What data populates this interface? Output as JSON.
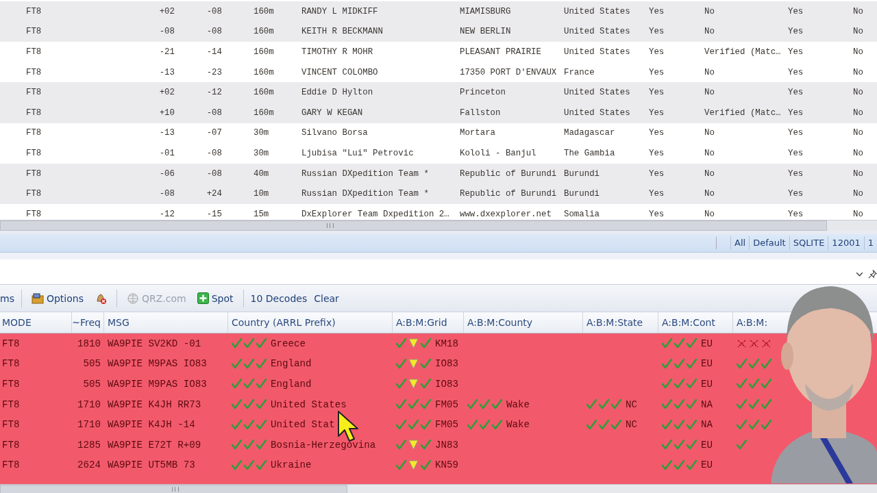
{
  "log_table": {
    "rows": [
      {
        "shaded": true,
        "cells": [
          "FT8",
          "+02",
          "-08",
          "160m",
          "RANDY L MIDKIFF",
          "MIAMISBURG",
          "United States",
          "Yes",
          "No",
          "Yes",
          "No"
        ]
      },
      {
        "shaded": true,
        "cells": [
          "FT8",
          "-08",
          "-08",
          "160m",
          "KEITH R BECKMANN",
          "NEW BERLIN",
          "United States",
          "Yes",
          "No",
          "Yes",
          "No"
        ]
      },
      {
        "shaded": false,
        "cells": [
          "FT8",
          "-21",
          "-14",
          "160m",
          "TIMOTHY R MOHR",
          "PLEASANT PRAIRIE",
          "United States",
          "Yes",
          "Verified (Matc…",
          "Yes",
          "No"
        ]
      },
      {
        "shaded": false,
        "cells": [
          "FT8",
          "-13",
          "-23",
          "160m",
          "VINCENT COLOMBO",
          "17350 PORT D'ENVAUX",
          "France",
          "Yes",
          "No",
          "Yes",
          "No"
        ]
      },
      {
        "shaded": true,
        "cells": [
          "FT8",
          "+02",
          "-12",
          "160m",
          "Eddie D Hylton",
          "Princeton",
          "United States",
          "Yes",
          "No",
          "Yes",
          "No"
        ]
      },
      {
        "shaded": true,
        "cells": [
          "FT8",
          "+10",
          "-08",
          "160m",
          "GARY W KEGAN",
          "Fallston",
          "United States",
          "Yes",
          "Verified (Matc…",
          "Yes",
          "No"
        ]
      },
      {
        "shaded": false,
        "cells": [
          "FT8",
          "-13",
          "-07",
          "30m",
          "Silvano Borsa",
          "Mortara",
          "Madagascar",
          "Yes",
          "No",
          "Yes",
          "No"
        ]
      },
      {
        "shaded": false,
        "cells": [
          "FT8",
          "-01",
          "-08",
          "30m",
          "Ljubisa \"Lui\" Petrovic",
          "Kololi - Banjul",
          "The Gambia",
          "Yes",
          "No",
          "Yes",
          "No"
        ]
      },
      {
        "shaded": true,
        "cells": [
          "FT8",
          "-06",
          "-08",
          "40m",
          "Russian DXpedition Team *",
          "Republic of Burundi",
          "Burundi",
          "Yes",
          "No",
          "Yes",
          "No"
        ]
      },
      {
        "shaded": true,
        "cells": [
          "FT8",
          "-08",
          "+24",
          "10m",
          "Russian DXpedition Team *",
          "Republic of Burundi",
          "Burundi",
          "Yes",
          "No",
          "Yes",
          "No"
        ]
      },
      {
        "shaded": false,
        "cells": [
          "FT8",
          "-12",
          "-15",
          "15m",
          "DxExplorer Team Dxpedition 2…",
          "www.dxexplorer.net",
          "Somalia",
          "Yes",
          "No",
          "Yes",
          "No"
        ]
      }
    ]
  },
  "status_bar": {
    "panes": [
      "All",
      "Default",
      "SQLITE",
      "12001",
      "1"
    ]
  },
  "toolbar": {
    "cut_item": "ms",
    "options_button": "Options",
    "qrz_button": {
      "label": "QRZ.com",
      "disabled": true
    },
    "spot_button": "Spot",
    "decodes_count": "10 Decodes",
    "clear_button": "Clear"
  },
  "decodes_table": {
    "columns": [
      "MODE",
      "~Freq",
      "MSG",
      "Country (ARRL Prefix)",
      "A:B:M:Grid",
      "A:B:M:County",
      "A:B:M:State",
      "A:B:M:Cont",
      "A:B:M:"
    ],
    "rows": [
      {
        "mode": "FT8",
        "freq": "1810",
        "msg": "WA9PIE SV2KD -01",
        "country": {
          "marks": [
            {
              "kind": "check"
            },
            {
              "kind": "check"
            },
            {
              "kind": "check"
            }
          ],
          "text": "Greece"
        },
        "grid": {
          "marks": [
            {
              "kind": "check"
            },
            {
              "kind": "warn"
            },
            {
              "kind": "check"
            }
          ],
          "text": "KM18"
        },
        "cont": {
          "marks": [
            {
              "kind": "check"
            },
            {
              "kind": "check"
            },
            {
              "kind": "check"
            }
          ],
          "text": "EU"
        },
        "column_9": {
          "marks": [
            {
              "kind": "cross"
            },
            {
              "kind": "cross"
            },
            {
              "kind": "cross"
            }
          ]
        }
      },
      {
        "mode": "FT8",
        "freq": "505",
        "msg": "WA9PIE M9PAS IO83",
        "country": {
          "marks": [
            {
              "kind": "check"
            },
            {
              "kind": "check"
            },
            {
              "kind": "check"
            }
          ],
          "text": "England"
        },
        "grid": {
          "marks": [
            {
              "kind": "check"
            },
            {
              "kind": "warn"
            },
            {
              "kind": "check"
            }
          ],
          "text": "IO83"
        },
        "cont": {
          "marks": [
            {
              "kind": "check"
            },
            {
              "kind": "check"
            },
            {
              "kind": "check"
            }
          ],
          "text": "EU"
        },
        "column_9": {
          "marks": [
            {
              "kind": "check"
            },
            {
              "kind": "check"
            },
            {
              "kind": "check"
            }
          ]
        }
      },
      {
        "mode": "FT8",
        "freq": "505",
        "msg": "WA9PIE M9PAS IO83",
        "country": {
          "marks": [
            {
              "kind": "check"
            },
            {
              "kind": "check"
            },
            {
              "kind": "check"
            }
          ],
          "text": "England"
        },
        "grid": {
          "marks": [
            {
              "kind": "check"
            },
            {
              "kind": "warn"
            },
            {
              "kind": "check"
            }
          ],
          "text": "IO83"
        },
        "cont": {
          "marks": [
            {
              "kind": "check"
            },
            {
              "kind": "check"
            },
            {
              "kind": "check"
            }
          ],
          "text": "EU"
        },
        "column_9": {
          "marks": [
            {
              "kind": "check"
            },
            {
              "kind": "check"
            },
            {
              "kind": "check"
            }
          ]
        }
      },
      {
        "mode": "FT8",
        "freq": "1710",
        "msg": "WA9PIE K4JH RR73",
        "country": {
          "marks": [
            {
              "kind": "check"
            },
            {
              "kind": "check"
            },
            {
              "kind": "check"
            }
          ],
          "text": "United States"
        },
        "grid": {
          "marks": [
            {
              "kind": "check"
            },
            {
              "kind": "check"
            },
            {
              "kind": "check"
            }
          ],
          "text": "FM05"
        },
        "county": {
          "marks": [
            {
              "kind": "check"
            },
            {
              "kind": "check"
            },
            {
              "kind": "check"
            }
          ],
          "text": "Wake"
        },
        "state": {
          "marks": [
            {
              "kind": "check"
            },
            {
              "kind": "check"
            },
            {
              "kind": "check"
            }
          ],
          "text": "NC"
        },
        "cont": {
          "marks": [
            {
              "kind": "check"
            },
            {
              "kind": "check"
            },
            {
              "kind": "check"
            }
          ],
          "text": "NA"
        },
        "column_9": {
          "marks": [
            {
              "kind": "check"
            },
            {
              "kind": "check"
            },
            {
              "kind": "check"
            }
          ]
        }
      },
      {
        "mode": "FT8",
        "freq": "1710",
        "msg": "WA9PIE K4JH -14",
        "country": {
          "marks": [
            {
              "kind": "check"
            },
            {
              "kind": "check"
            },
            {
              "kind": "check"
            }
          ],
          "text": "United Stat"
        },
        "grid": {
          "marks": [
            {
              "kind": "check"
            },
            {
              "kind": "check"
            },
            {
              "kind": "check"
            }
          ],
          "text": "FM05"
        },
        "county": {
          "marks": [
            {
              "kind": "check"
            },
            {
              "kind": "check"
            },
            {
              "kind": "check"
            }
          ],
          "text": "Wake"
        },
        "state": {
          "marks": [
            {
              "kind": "check"
            },
            {
              "kind": "check"
            },
            {
              "kind": "check"
            }
          ],
          "text": "NC"
        },
        "cont": {
          "marks": [
            {
              "kind": "check"
            },
            {
              "kind": "check"
            },
            {
              "kind": "check"
            }
          ],
          "text": "NA"
        },
        "column_9": {
          "marks": [
            {
              "kind": "check"
            },
            {
              "kind": "check"
            },
            {
              "kind": "check"
            }
          ]
        }
      },
      {
        "mode": "FT8",
        "freq": "1285",
        "msg": "WA9PIE E72T R+09",
        "country": {
          "marks": [
            {
              "kind": "check"
            },
            {
              "kind": "check"
            },
            {
              "kind": "check"
            }
          ],
          "text": "Bosnia-Herzegovina"
        },
        "grid": {
          "marks": [
            {
              "kind": "check"
            },
            {
              "kind": "warn"
            },
            {
              "kind": "check"
            }
          ],
          "text": "JN83"
        },
        "cont": {
          "marks": [
            {
              "kind": "check"
            },
            {
              "kind": "check"
            },
            {
              "kind": "check"
            }
          ],
          "text": "EU"
        },
        "column_9": {
          "marks": [
            {
              "kind": "check"
            }
          ]
        }
      },
      {
        "mode": "FT8",
        "freq": "2624",
        "msg": "WA9PIE UT5MB 73",
        "country": {
          "marks": [
            {
              "kind": "check"
            },
            {
              "kind": "check"
            },
            {
              "kind": "check"
            }
          ],
          "text": "Ukraine"
        },
        "grid": {
          "marks": [
            {
              "kind": "check"
            },
            {
              "kind": "warn"
            },
            {
              "kind": "check"
            }
          ],
          "text": "KN59"
        },
        "cont": {
          "marks": [
            {
              "kind": "check"
            },
            {
              "kind": "check"
            },
            {
              "kind": "check"
            }
          ],
          "text": "EU"
        }
      }
    ]
  }
}
